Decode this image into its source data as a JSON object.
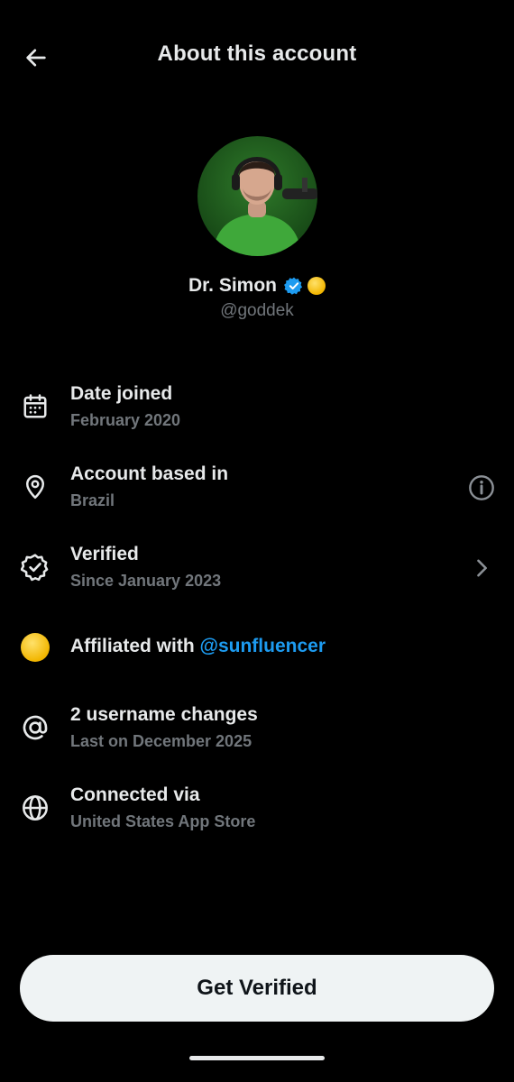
{
  "header": {
    "title": "About this account",
    "back_icon": "arrow-left-icon"
  },
  "profile": {
    "name": "Dr. Simon",
    "handle": "@goddek",
    "verified_color": "#1d9bf0",
    "affiliate_badge_color": "#f2b600"
  },
  "rows": [
    {
      "icon": "calendar-icon",
      "primary": "Date joined",
      "secondary": "February 2020"
    },
    {
      "icon": "location-pin-icon",
      "primary": "Account based in",
      "secondary": "Brazil",
      "trailing_icon": "info-icon"
    },
    {
      "icon": "verified-badge-icon",
      "primary": "Verified",
      "secondary": "Since January 2023",
      "trailing_icon": "chevron-right-icon"
    },
    {
      "icon": "affiliate-badge-icon",
      "primary": "Affiliated with ",
      "link": "@sunfluencer"
    },
    {
      "icon": "at-sign-icon",
      "primary": "2 username changes",
      "secondary": "Last on December 2025"
    },
    {
      "icon": "globe-icon",
      "primary": "Connected via",
      "secondary": "United States App Store"
    }
  ],
  "cta": {
    "label": "Get Verified"
  },
  "colors": {
    "background": "#000000",
    "text": "#e7e9ea",
    "muted": "#71767b",
    "link": "#1d9bf0",
    "button_bg": "#eff3f4"
  }
}
